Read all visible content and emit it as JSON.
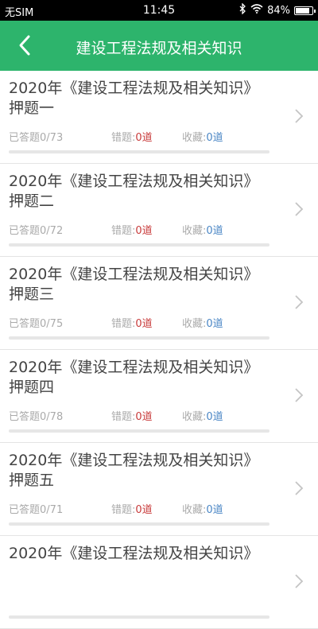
{
  "status_bar": {
    "carrier": "无SIM",
    "time": "11:45",
    "battery": "84%",
    "battery_level": 0.84
  },
  "nav": {
    "title": "建设工程法规及相关知识"
  },
  "labels": {
    "answered": "已答题",
    "wrong": "错题:",
    "favorite": "收藏:"
  },
  "items": [
    {
      "title": "2020年《建设工程法规及相关知识》押题一",
      "answered": "0/73",
      "wrong": "0道",
      "favorite": "0道",
      "progress": 0
    },
    {
      "title": "2020年《建设工程法规及相关知识》押题二",
      "answered": "0/72",
      "wrong": "0道",
      "favorite": "0道",
      "progress": 0
    },
    {
      "title": "2020年《建设工程法规及相关知识》押题三",
      "answered": "0/75",
      "wrong": "0道",
      "favorite": "0道",
      "progress": 0
    },
    {
      "title": "2020年《建设工程法规及相关知识》押题四",
      "answered": "0/78",
      "wrong": "0道",
      "favorite": "0道",
      "progress": 0
    },
    {
      "title": "2020年《建设工程法规及相关知识》押题五",
      "answered": "0/71",
      "wrong": "0道",
      "favorite": "0道",
      "progress": 0
    },
    {
      "title": "2020年《建设工程法规及相关知识》",
      "answered": "",
      "wrong": "",
      "favorite": "",
      "progress": 0
    }
  ],
  "colors": {
    "accent": "#2db46c",
    "wrong": "#c83a3a",
    "favorite": "#4a86c5"
  }
}
